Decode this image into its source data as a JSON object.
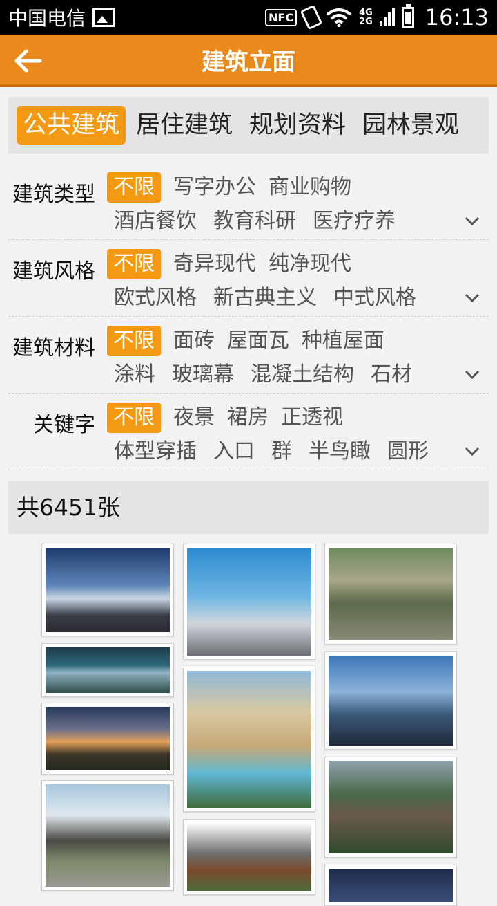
{
  "status": {
    "carrier": "中国电信",
    "nfc": "NFC",
    "net_top": "4G",
    "net_bottom": "2G",
    "time": "16:13"
  },
  "header": {
    "title": "建筑立面"
  },
  "tabs": [
    {
      "label": "公共建筑",
      "active": true
    },
    {
      "label": "居住建筑",
      "active": false
    },
    {
      "label": "规划资料",
      "active": false
    },
    {
      "label": "园林景观",
      "active": false
    }
  ],
  "filters": [
    {
      "label": "建筑类型",
      "line1": [
        "不限",
        "写字办公",
        "商业购物"
      ],
      "line2": [
        "酒店餐饮",
        "教育科研",
        "医疗疗养"
      ]
    },
    {
      "label": "建筑风格",
      "line1": [
        "不限",
        "奇异现代",
        "纯净现代"
      ],
      "line2": [
        "欧式风格",
        "新古典主义",
        "中式风格"
      ]
    },
    {
      "label": "建筑材料",
      "line1": [
        "不限",
        "面砖",
        "屋面瓦",
        "种植屋面"
      ],
      "line2": [
        "涂料",
        "玻璃幕",
        "混凝土结构",
        "石材"
      ]
    },
    {
      "label": "关键字",
      "line1": [
        "不限",
        "夜景",
        "裙房",
        "正透视"
      ],
      "line2": [
        "体型穿插",
        "入口",
        "群",
        "半鸟瞰",
        "圆形"
      ]
    }
  ],
  "count": "共6451张",
  "colors": {
    "accent": "#f39a12",
    "header": "#ea8a1c"
  }
}
